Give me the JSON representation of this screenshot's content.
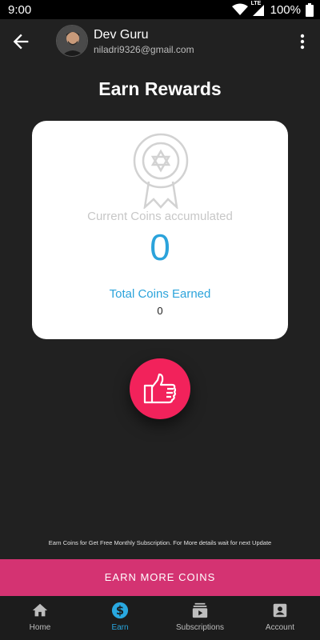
{
  "status_bar": {
    "time": "9:00",
    "network_label": "LTE",
    "battery": "100%",
    "icons": [
      "wifi-icon",
      "signal-icon",
      "battery-icon"
    ]
  },
  "header": {
    "user_name": "Dev Guru",
    "user_email": "niladri9326@gmail.com",
    "icons": [
      "back-arrow-icon",
      "avatar",
      "more-vert-icon"
    ]
  },
  "page": {
    "title": "Earn Rewards"
  },
  "rewards_card": {
    "icon": "award-badge-icon",
    "current_label": "Current Coins accumulated",
    "current_value": "0",
    "total_label": "Total Coins Earned",
    "total_value": "0"
  },
  "like_button": {
    "icon": "thumbs-up-icon"
  },
  "footnote": "Earn Coins for Get Free Monthly Subscription. For More details wait for next Update",
  "earn_button": {
    "label": "EARN MORE COINS"
  },
  "bottom_nav": {
    "active": "Earn",
    "items": [
      {
        "label": "Home",
        "icon": "home-icon"
      },
      {
        "label": "Earn",
        "icon": "dollar-icon"
      },
      {
        "label": "Subscriptions",
        "icon": "subscriptions-icon"
      },
      {
        "label": "Account",
        "icon": "account-icon"
      }
    ]
  },
  "colors": {
    "background": "#212121",
    "accent_blue": "#2ba3db",
    "like_button": "#f2225b",
    "earn_button": "#d43372",
    "nav_background": "#1c1c1c"
  }
}
